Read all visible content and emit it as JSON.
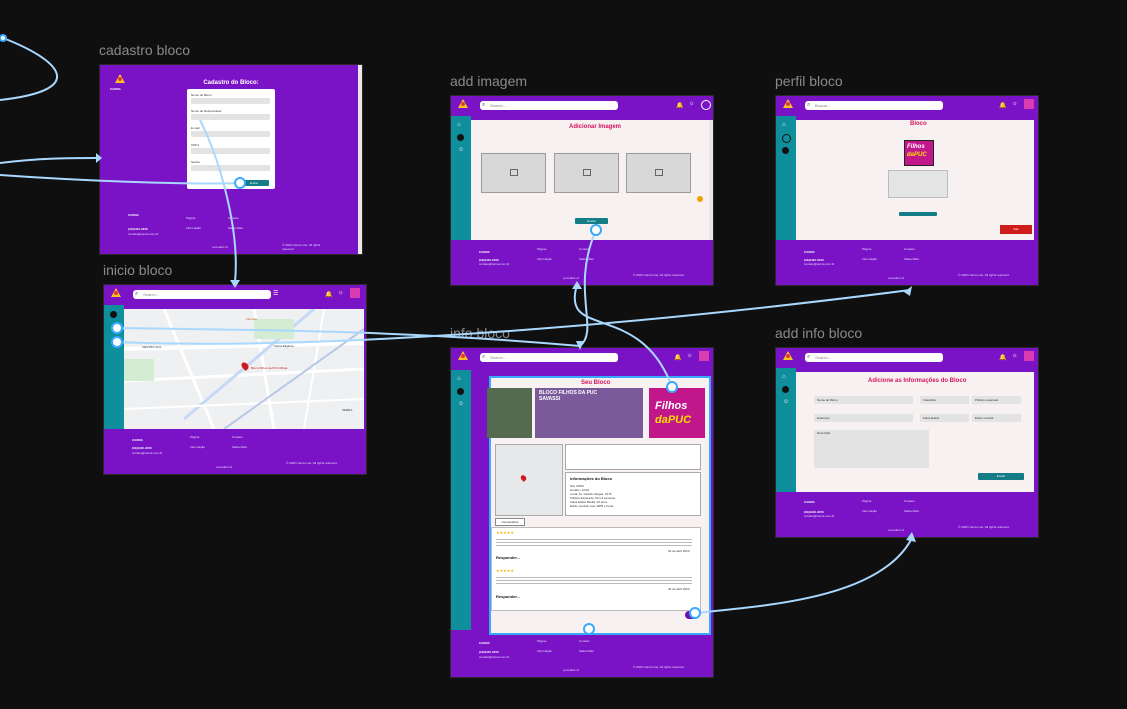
{
  "frames": {
    "cadastro": {
      "label": "cadastro bloco",
      "form_title": "Cadastro do Bloco:",
      "fields": [
        "Nome do Bloco",
        "Nome do Responsável",
        "E-mail",
        "CNPJ",
        "Senha"
      ],
      "submit": "Entrar"
    },
    "add_imagem": {
      "label": "add imagem",
      "search_placeholder": "Search...",
      "title": "Adicionar Imagem",
      "submit": "Enviar"
    },
    "perfil": {
      "label": "perfil bloco",
      "search_placeholder": "Buscar...",
      "title": "Bloco",
      "badge_top": "Filhos",
      "badge_bottom": "daPUC",
      "delete": "Sair"
    },
    "inicio": {
      "label": "inicio bloco",
      "search_placeholder": "Search...",
      "map_labels": [
        "Floresta",
        "Santa Efigênia",
        "CENTRO-SUL",
        "Bloco Filhos da PUC Minas",
        "SERRA"
      ]
    },
    "info": {
      "label": "info bloco",
      "search_placeholder": "Search...",
      "title": "Seu Bloco",
      "photo_caption": "BLOCO FILHOS DA PUC SAVASSI",
      "badge_top": "Filhos",
      "badge_bottom": "daPUC",
      "info_title": "Informações do Bloco",
      "info_lines": [
        "Dia: 03/03",
        "Horário: 14:00",
        "Local: Av. Getúlio Vargas, 1575",
        "Público Esperado: 50 mil pessoas",
        "Faixa Etária Média: 20 anos",
        "Estilo musical: Axé, MPB e Funk"
      ],
      "comments_tab": "Comentários",
      "reply_1": "Responder...",
      "reply_2": "Responder...",
      "date_1": "02 de abril 2023",
      "date_2": "02 de abril 2023"
    },
    "add_info": {
      "label": "add info bloco",
      "search_placeholder": "Search...",
      "title": "Adicione as Informações do Bloco",
      "fields": [
        "Nome do Bloco",
        "Classifica",
        "Público esperado",
        "Endereço",
        "Faixa Etária",
        "Estilo musical",
        "Descrição"
      ],
      "submit": "Enviar"
    }
  },
  "footer": {
    "brand": "CARNA",
    "phone": "(31)9440-0456",
    "email": "contato@carna.com.br",
    "links_1": [
      "Página",
      "Informação"
    ],
    "links_2": [
      "Contato",
      "Saiba Mais"
    ],
    "produced": "a product of",
    "copyright": "© 2023 Carna Line. All rights reserved"
  },
  "colors": {
    "purple": "#7a13c6",
    "teal": "#0f8f9c",
    "pink": "#d4135f",
    "wire": "#a9d8ff",
    "canvas": "#0f0f10"
  }
}
